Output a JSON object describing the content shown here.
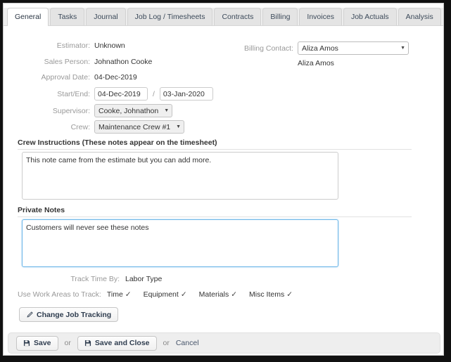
{
  "tabs": [
    {
      "label": "General",
      "active": true
    },
    {
      "label": "Tasks",
      "active": false
    },
    {
      "label": "Journal",
      "active": false
    },
    {
      "label": "Job Log / Timesheets",
      "active": false
    },
    {
      "label": "Contracts",
      "active": false
    },
    {
      "label": "Billing",
      "active": false
    },
    {
      "label": "Invoices",
      "active": false
    },
    {
      "label": "Job Actuals",
      "active": false
    },
    {
      "label": "Analysis",
      "active": false
    }
  ],
  "form": {
    "estimator_label": "Estimator:",
    "estimator_value": "Unknown",
    "sales_person_label": "Sales Person:",
    "sales_person_value": "Johnathon Cooke",
    "approval_date_label": "Approval Date:",
    "approval_date_value": "04-Dec-2019",
    "start_end_label": "Start/End:",
    "start_date_value": "04-Dec-2019",
    "end_date_value": "03-Jan-2020",
    "date_separator": "/",
    "supervisor_label": "Supervisor:",
    "supervisor_value": "Cooke, Johnathon",
    "crew_label": "Crew:",
    "crew_value": "Maintenance Crew #1",
    "billing_contact_label": "Billing Contact:",
    "billing_contact_value": "Aliza Amos",
    "billing_contact_name": "Aliza Amos"
  },
  "crew_instructions": {
    "heading": "Crew Instructions (These notes appear on the timesheet)",
    "value": "This note came from the estimate but you can add more."
  },
  "private_notes": {
    "heading": "Private Notes",
    "value": "Customers will never see these notes"
  },
  "tracking": {
    "track_time_by_label": "Track Time By:",
    "track_time_by_value": "Labor Type",
    "work_areas_label": "Use Work Areas to Track:",
    "work_areas": [
      {
        "name": "Time",
        "checked": "✓"
      },
      {
        "name": "Equipment",
        "checked": "✓"
      },
      {
        "name": "Materials",
        "checked": "✓"
      },
      {
        "name": "Misc Items",
        "checked": "✓"
      }
    ],
    "change_button_label": "Change Job Tracking"
  },
  "footer": {
    "save_label": "Save",
    "or_1": "or",
    "save_and_close_label": "Save and Close",
    "or_2": "or",
    "cancel_label": "Cancel"
  },
  "colors": {
    "accent_focus": "#6cb6e8",
    "tab_active_bg": "#ffffff",
    "tab_bar_bg": "#eeeeee",
    "label_gray": "#999999",
    "value_dark": "#333333"
  }
}
